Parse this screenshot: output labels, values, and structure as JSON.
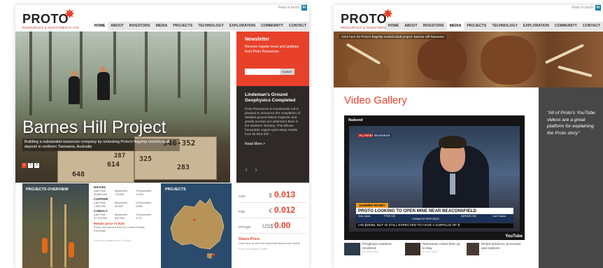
{
  "left": {
    "logo": {
      "word": "PROTO",
      "sub": "RESOURCES & INVESTMENTS LTD"
    },
    "keep_in_touch": "Keep in touch",
    "nav": [
      "HOME",
      "ABOUT",
      "INVESTORS",
      "MEDIA",
      "PROJECTS",
      "TECHNOLOGY",
      "EXPLORATION",
      "COMMUNITY",
      "CONTACT"
    ],
    "active_nav": "HOME",
    "hero": {
      "title": "Barnes Hill Project",
      "description": "Building a substantial resources company by unlocking Proto's flagship nickel/cobalt deposit in northern Tasmania, Australia",
      "dots": [
        "1",
        "2",
        "3"
      ],
      "crate_numbers": [
        "346-352",
        "287",
        "614",
        "325",
        "283",
        "648"
      ]
    },
    "newsletter": {
      "title": "Newsletter",
      "text": "Receive regular news and updates from Proto Resources",
      "submit": "SUBMIT"
    },
    "news": {
      "title": "Lindeman's Ground Geophysics Completed",
      "body": "Proto Resources & Investments Ltd is pleased to announce the completion of detailed ground based magnetic and gravity surveys at Lindeman's Bore in the Northern Territory. This follows favourable copper-gold assay results from its third drill ...",
      "more": "Read More >"
    },
    "projects_overview_title": "PROJECTS OVERVIEW",
    "metals": [
      {
        "name": "NICKEL",
        "headers": [
          "Last Price",
          "Movement",
          "% Movement"
        ],
        "values": [
          "25,880.000",
          "-75.000",
          "-0.409"
        ]
      },
      {
        "name": "COPPER",
        "headers": [
          "Last Price",
          "Movement",
          "% Movement"
        ],
        "values": [
          "7,555.000",
          "44.000",
          "0.583"
        ]
      },
      {
        "name": "COBALT",
        "headers": [
          "Last Price",
          "Movement",
          "% Movement"
        ],
        "values": [
          "27,700.000",
          "200.000",
          "0.727"
        ]
      }
    ],
    "metals_link": "Metals price in $US",
    "metals_note": "Prices are sourced from the London Metals Exchange",
    "metals_updated": "Prices are updated every 24 hours",
    "projects_title": "PROJECTS",
    "shares": [
      {
        "exchange": "ASX",
        "currency": "$",
        "value": "0.013"
      },
      {
        "exchange": "FSE",
        "currency": "€",
        "value": "0.012"
      },
      {
        "exchange": "OTCQX",
        "currency": "US$",
        "value": "0.00"
      }
    ],
    "share_price": {
      "title": "Share Price",
      "note": "Click here to view the historical share price charts",
      "delay": "Prices are delayed 20mins"
    }
  },
  "right": {
    "logo": {
      "word": "PROTO",
      "sub": "RESOURCES & INVESTMENTS LTD"
    },
    "keep_in_touch": "Keep in touch",
    "nav": [
      "HOME",
      "ABOUT",
      "INVESTORS",
      "MEDIA",
      "PROJECTS",
      "TECHNOLOGY",
      "EXPLORATION",
      "COMMUNITY",
      "CONTACT"
    ],
    "active_nav": "MEDIA",
    "breadcrumb": "Click here for Proto's flagship nickel/cobalt project: Barnes Hill Tasmania",
    "title": "Video Gallery",
    "video": {
      "source_logo": "fladsend",
      "channel_tag": "sky NEWS",
      "section": "BUSINESS",
      "lower_third_label": "SUMMER MONEY",
      "headline": "PROTO LOOKING TO OPEN MINE NEAR BEACONSFIELD",
      "markets": [
        "Dow Jones",
        "FTSE 100",
        "COMMLTH PROP SECS",
        "S&P/ASX 200",
        "Live Futures"
      ],
      "scroll": "IAN $200M, BUT IS STILL EXPECTED TO HAVE A SURPLUS OF $",
      "youtube": "YouTube"
    },
    "thumbs": [
      {
        "title": "Penghana Gardens rendered",
        "date": "24 JUNE 2013"
      },
      {
        "title": "Tasmanian nickel fires up to stay",
        "date": "21 JULY 2013"
      },
      {
        "title": "Nickel producer, processor and explorer",
        "date": ""
      }
    ],
    "quote": "\"All of Proto's YouTube videos are a great platform for explaining the Proto story\""
  },
  "colors": {
    "accent": "#e8412a",
    "dark_panel": "#2f2a27",
    "grey_panel": "#474747"
  },
  "icons": [
    "linkedin-icon",
    "logo-star-icon",
    "left-arrow-icon",
    "right-arrow-icon",
    "youtube-icon"
  ]
}
